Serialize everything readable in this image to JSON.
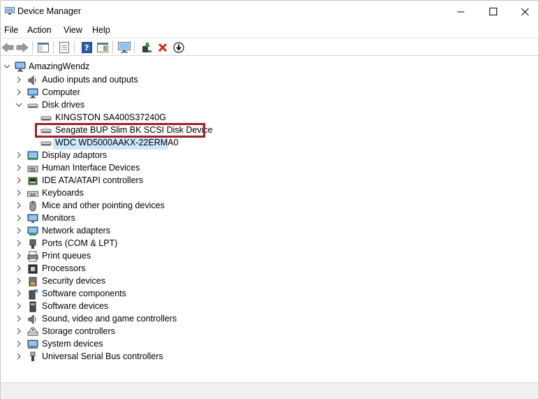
{
  "window": {
    "title": "Device Manager"
  },
  "menu": {
    "file": "File",
    "action": "Action",
    "view": "View",
    "help": "Help"
  },
  "tree": {
    "root": "AmazingWendz",
    "categories": [
      "Audio inputs and outputs",
      "Computer",
      "Disk drives",
      "Display adaptors",
      "Human Interface Devices",
      "IDE ATA/ATAPI controllers",
      "Keyboards",
      "Mice and other pointing devices",
      "Monitors",
      "Network adapters",
      "Ports (COM & LPT)",
      "Print queues",
      "Processors",
      "Security devices",
      "Software components",
      "Software devices",
      "Sound, video and game controllers",
      "Storage controllers",
      "System devices",
      "Universal Serial Bus controllers"
    ],
    "disk_drives": [
      "KINGSTON SA400S37240G",
      "Seagate BUP Slim BK SCSI Disk Device",
      "WDC WD5000AAKX-22ERMA0"
    ]
  },
  "colors": {
    "selection": "#cce8ff",
    "highlight_border": "#a0202a",
    "delete_red": "#d42020",
    "update_green": "#2e8b2e"
  }
}
